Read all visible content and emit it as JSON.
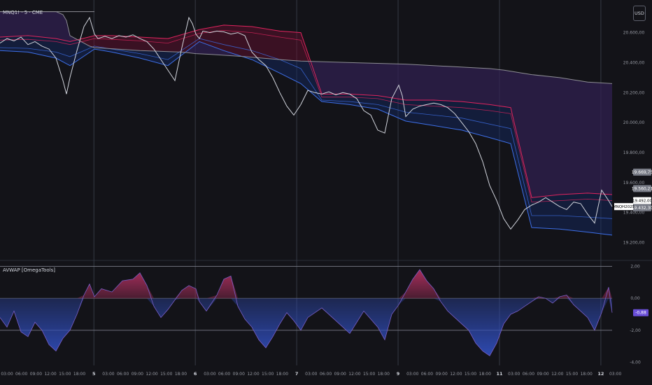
{
  "header": {
    "symbol_title": "MNQ1! · 5 · CME",
    "currency_button": "USD"
  },
  "indicator": {
    "title": "AVWAP [OmegaTools]"
  },
  "colors": {
    "background": "#131318",
    "grid": "#2a2e39",
    "price": "#d1d4dc",
    "upper_band": "#e0245e",
    "upper_fill": "#6b1030",
    "lower_band": "#3d6fe8",
    "lower_fill": "#142a66",
    "vwap_line": "#8e8e95",
    "osc_pos": "#b03060",
    "osc_neg": "#2f4cb8"
  },
  "chart_data": [
    {
      "type": "line",
      "title": "MNQ1! · 5 · CME",
      "yticks": [
        "20.600,00",
        "20.400,00",
        "20.200,00",
        "20.000,00",
        "19.800,00",
        "19.600,00",
        "19.400,00",
        "19.200,00"
      ],
      "ylim": [
        19100,
        20780
      ],
      "price_tags": [
        {
          "text": "19.669,75",
          "value": 19669.75,
          "color": "#787b86"
        },
        {
          "text": "19.560,21",
          "value": 19560.21,
          "color": "#787b86"
        },
        {
          "text": "19.492,00",
          "value": 19480,
          "color": "#ffffff"
        },
        {
          "text": "19.432,30",
          "value": 19432.3,
          "color": "#787b86"
        }
      ],
      "symbol_tag": "MNQH2025",
      "x_ticks": [
        "03:00",
        "06:00",
        "09:00",
        "12:00",
        "15:00",
        "18:00",
        "5",
        "03:00",
        "06:00",
        "09:00",
        "12:00",
        "15:00",
        "18:00",
        "6",
        "03:00",
        "06:00",
        "09:00",
        "12:00",
        "15:00",
        "18:00",
        "7",
        "03:00",
        "06:00",
        "09:00",
        "12:00",
        "15:00",
        "18:00",
        "9",
        "03:00",
        "06:00",
        "09:00",
        "12:00",
        "15:00",
        "18:00",
        "11",
        "03:00",
        "06:00",
        "09:00",
        "12:00",
        "15:00",
        "18:00",
        "12",
        "03:00"
      ],
      "day_separators": [
        "5",
        "6",
        "7",
        "9",
        "11",
        "12"
      ],
      "series": [
        {
          "role": "price",
          "x": [
            0,
            10,
            20,
            30,
            40,
            50,
            60,
            70,
            80,
            90,
            95,
            100,
            110,
            120,
            128,
            135,
            140,
            150,
            160,
            170,
            180,
            190,
            200,
            210,
            220,
            230,
            240,
            250,
            260,
            270,
            275,
            280,
            285,
            290,
            300,
            310,
            320,
            330,
            340,
            350,
            360,
            370,
            380,
            390,
            400,
            410,
            420,
            430,
            440,
            450,
            460,
            470,
            480,
            490,
            500,
            510,
            520,
            530,
            540,
            550,
            560,
            570,
            575,
            580,
            590,
            600,
            610,
            620,
            630,
            640,
            650,
            660,
            670,
            680,
            690,
            700,
            710,
            720,
            730,
            740,
            750,
            760,
            770,
            780,
            790,
            800,
            810,
            820,
            830,
            840,
            850,
            860,
            870,
            875
          ],
          "values": [
            20530,
            20560,
            20545,
            20570,
            20520,
            20540,
            20510,
            20490,
            20430,
            20280,
            20190,
            20300,
            20480,
            20640,
            20700,
            20590,
            20560,
            20575,
            20560,
            20580,
            20570,
            20585,
            20560,
            20540,
            20490,
            20420,
            20350,
            20280,
            20500,
            20700,
            20660,
            20590,
            20560,
            20610,
            20600,
            20610,
            20605,
            20590,
            20600,
            20580,
            20470,
            20420,
            20380,
            20300,
            20200,
            20110,
            20050,
            20120,
            20215,
            20200,
            20190,
            20205,
            20185,
            20200,
            20190,
            20160,
            20080,
            20050,
            19950,
            19930,
            20160,
            20250,
            20180,
            20040,
            20090,
            20110,
            20120,
            20130,
            20120,
            20100,
            20060,
            20000,
            19940,
            19860,
            19740,
            19580,
            19480,
            19360,
            19290,
            19350,
            19420,
            19450,
            19470,
            19500,
            19470,
            19440,
            19420,
            19470,
            19460,
            19390,
            19330,
            19550,
            19480,
            19440
          ]
        },
        {
          "role": "vwap_segment",
          "name": "",
          "x": [
            0,
            135
          ],
          "values": [
            20740,
            20740
          ]
        },
        {
          "role": "vwap_long",
          "x": [
            0,
            60,
            80,
            90,
            95,
            100,
            120,
            128,
            135,
            200,
            260,
            280,
            300,
            350,
            400,
            430,
            500,
            580,
            640,
            700,
            720,
            760,
            800,
            840,
            875
          ],
          "values": [
            20740,
            20740,
            20740,
            20720,
            20680,
            20580,
            20530,
            20510,
            20500,
            20480,
            20470,
            20460,
            20455,
            20440,
            20420,
            20410,
            20400,
            20390,
            20375,
            20360,
            20350,
            20320,
            20300,
            20270,
            20260
          ]
        },
        {
          "role": "upper_outer",
          "x": [
            0,
            40,
            80,
            100,
            135,
            160,
            200,
            240,
            285,
            320,
            360,
            400,
            430,
            460,
            500,
            540,
            580,
            620,
            660,
            700,
            730,
            760,
            800,
            840,
            875
          ],
          "values": [
            20570,
            20580,
            20560,
            20540,
            20580,
            20580,
            20570,
            20560,
            20620,
            20650,
            20640,
            20610,
            20600,
            20190,
            20190,
            20180,
            20150,
            20150,
            20140,
            20120,
            20100,
            19500,
            19520,
            19530,
            19520
          ]
        },
        {
          "role": "upper_inner",
          "x": [
            0,
            40,
            80,
            100,
            135,
            160,
            200,
            240,
            285,
            320,
            360,
            400,
            430,
            460,
            500,
            540,
            580,
            620,
            660,
            700,
            730,
            760,
            800,
            840,
            875
          ],
          "values": [
            20550,
            20555,
            20540,
            20520,
            20560,
            20555,
            20545,
            20530,
            20595,
            20615,
            20600,
            20570,
            20550,
            20170,
            20170,
            20160,
            20120,
            20110,
            20100,
            20080,
            20060,
            19470,
            19480,
            19490,
            19480
          ]
        },
        {
          "role": "lower_inner",
          "x": [
            0,
            40,
            80,
            100,
            135,
            160,
            200,
            240,
            285,
            320,
            360,
            400,
            430,
            460,
            500,
            540,
            580,
            620,
            660,
            700,
            730,
            760,
            800,
            840,
            875
          ],
          "values": [
            20500,
            20495,
            20470,
            20440,
            20510,
            20490,
            20460,
            20420,
            20560,
            20520,
            20480,
            20420,
            20360,
            20150,
            20140,
            20120,
            20070,
            20050,
            20030,
            19990,
            19960,
            19380,
            19380,
            19370,
            19360
          ]
        },
        {
          "role": "lower_outer",
          "x": [
            0,
            40,
            80,
            100,
            135,
            160,
            200,
            240,
            285,
            320,
            360,
            400,
            430,
            460,
            500,
            540,
            580,
            620,
            660,
            700,
            730,
            760,
            800,
            840,
            875
          ],
          "values": [
            20480,
            20470,
            20430,
            20380,
            20490,
            20470,
            20430,
            20380,
            20540,
            20480,
            20420,
            20330,
            20260,
            20140,
            20120,
            20090,
            20010,
            19980,
            19950,
            19900,
            19860,
            19300,
            19290,
            19270,
            19250
          ]
        }
      ]
    },
    {
      "type": "area",
      "title": "AVWAP [OmegaTools]",
      "yticks": [
        "2,00",
        "0,00",
        "-2,00",
        "-4,00"
      ],
      "ylim": [
        -4.2,
        2.2
      ],
      "value_tag": "-0,88",
      "levels": [
        2,
        0,
        -2
      ],
      "series": [
        {
          "x": [
            0,
            10,
            20,
            30,
            40,
            50,
            60,
            70,
            80,
            90,
            100,
            110,
            120,
            128,
            135,
            145,
            160,
            175,
            190,
            200,
            210,
            220,
            230,
            240,
            250,
            260,
            270,
            280,
            285,
            295,
            310,
            320,
            330,
            340,
            350,
            360,
            370,
            380,
            390,
            400,
            410,
            420,
            430,
            440,
            460,
            480,
            500,
            520,
            540,
            550,
            560,
            570,
            580,
            590,
            600,
            610,
            620,
            630,
            640,
            650,
            660,
            670,
            680,
            690,
            700,
            710,
            720,
            730,
            740,
            750,
            760,
            770,
            780,
            790,
            800,
            810,
            820,
            830,
            840,
            850,
            860,
            870,
            875
          ],
          "values": [
            -1.2,
            -1.8,
            -0.8,
            -2.1,
            -2.4,
            -1.5,
            -2.0,
            -2.9,
            -3.3,
            -2.5,
            -2.0,
            -1.0,
            0.2,
            0.9,
            0.1,
            0.6,
            0.4,
            1.1,
            1.2,
            1.6,
            0.8,
            -0.5,
            -1.2,
            -0.7,
            -0.1,
            0.5,
            0.8,
            0.6,
            -0.2,
            -0.8,
            0.2,
            1.2,
            1.4,
            -0.5,
            -1.3,
            -1.8,
            -2.6,
            -3.1,
            -2.4,
            -1.6,
            -0.9,
            -1.4,
            -2.0,
            -1.2,
            -0.6,
            -1.4,
            -2.2,
            -0.8,
            -1.8,
            -2.6,
            -1.0,
            -0.4,
            0.4,
            1.2,
            1.8,
            1.1,
            0.6,
            -0.2,
            -0.8,
            -1.2,
            -1.6,
            -2.0,
            -2.8,
            -3.3,
            -3.6,
            -2.8,
            -1.6,
            -1.0,
            -0.8,
            -0.5,
            -0.2,
            0.1,
            0.0,
            -0.3,
            0.1,
            0.2,
            -0.4,
            -0.8,
            -1.2,
            -2.0,
            -0.9,
            0.7,
            -0.9
          ]
        }
      ]
    }
  ]
}
